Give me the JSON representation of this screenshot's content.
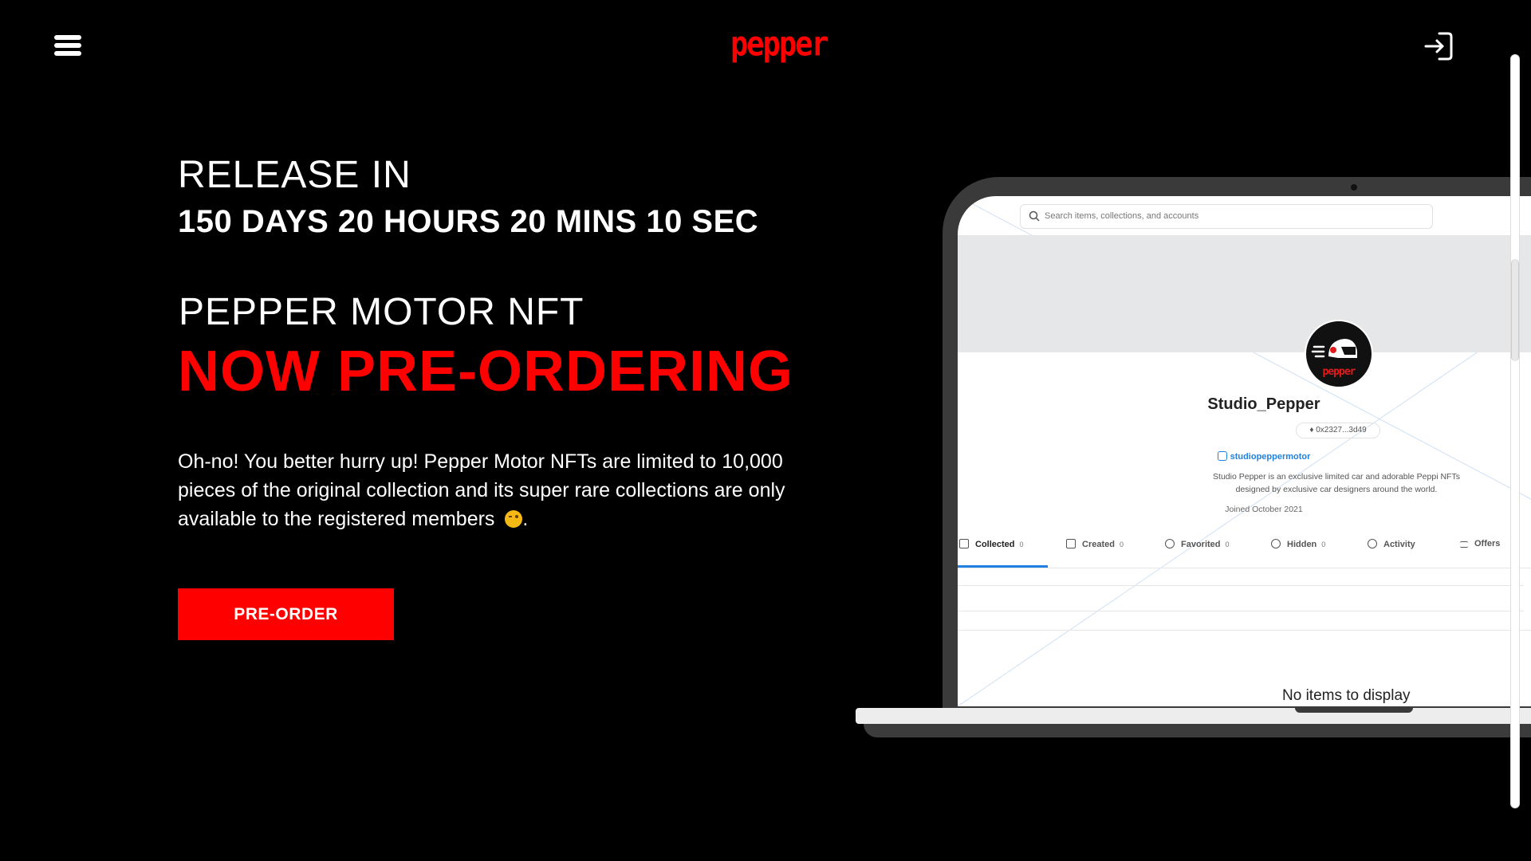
{
  "brand": {
    "logo_text": "pepper",
    "accent_color": "#ff0000"
  },
  "header": {
    "menu_icon": "hamburger-menu-icon",
    "login_icon": "sign-in-icon"
  },
  "hero": {
    "release_label": "RELEASE IN",
    "countdown": "150 DAYS 20 HOURS 20 MINS 10 SEC",
    "product_label": "PEPPER MOTOR NFT",
    "headline": "NOW PRE-ORDERING",
    "description": "Oh-no! You better hurry up! Pepper Motor NFTs are limited to 10,000 pieces of the original collection and its super rare collections are only available to the registered members",
    "description_end": ".",
    "emoji": "winking-face",
    "cta_label": "PRE-ORDER"
  },
  "mockup": {
    "search_placeholder": "Search items, collections, and accounts",
    "avatar_text": "pepper",
    "username": "Studio_Pepper",
    "wallet": "0x2327...3d49",
    "instagram": "studiopeppermotor",
    "bio": "Studio Pepper is an exclusive limited car and adorable Peppi NFTs designed by exclusive car designers around the world.",
    "joined": "Joined October 2021",
    "tabs": [
      {
        "label": "Collected",
        "count": "0"
      },
      {
        "label": "Created",
        "count": "0"
      },
      {
        "label": "Favorited",
        "count": "0"
      },
      {
        "label": "Hidden",
        "count": "0"
      },
      {
        "label": "Activity",
        "count": ""
      },
      {
        "label": "Offers",
        "count": ""
      }
    ],
    "empty_message": "No items to display"
  }
}
